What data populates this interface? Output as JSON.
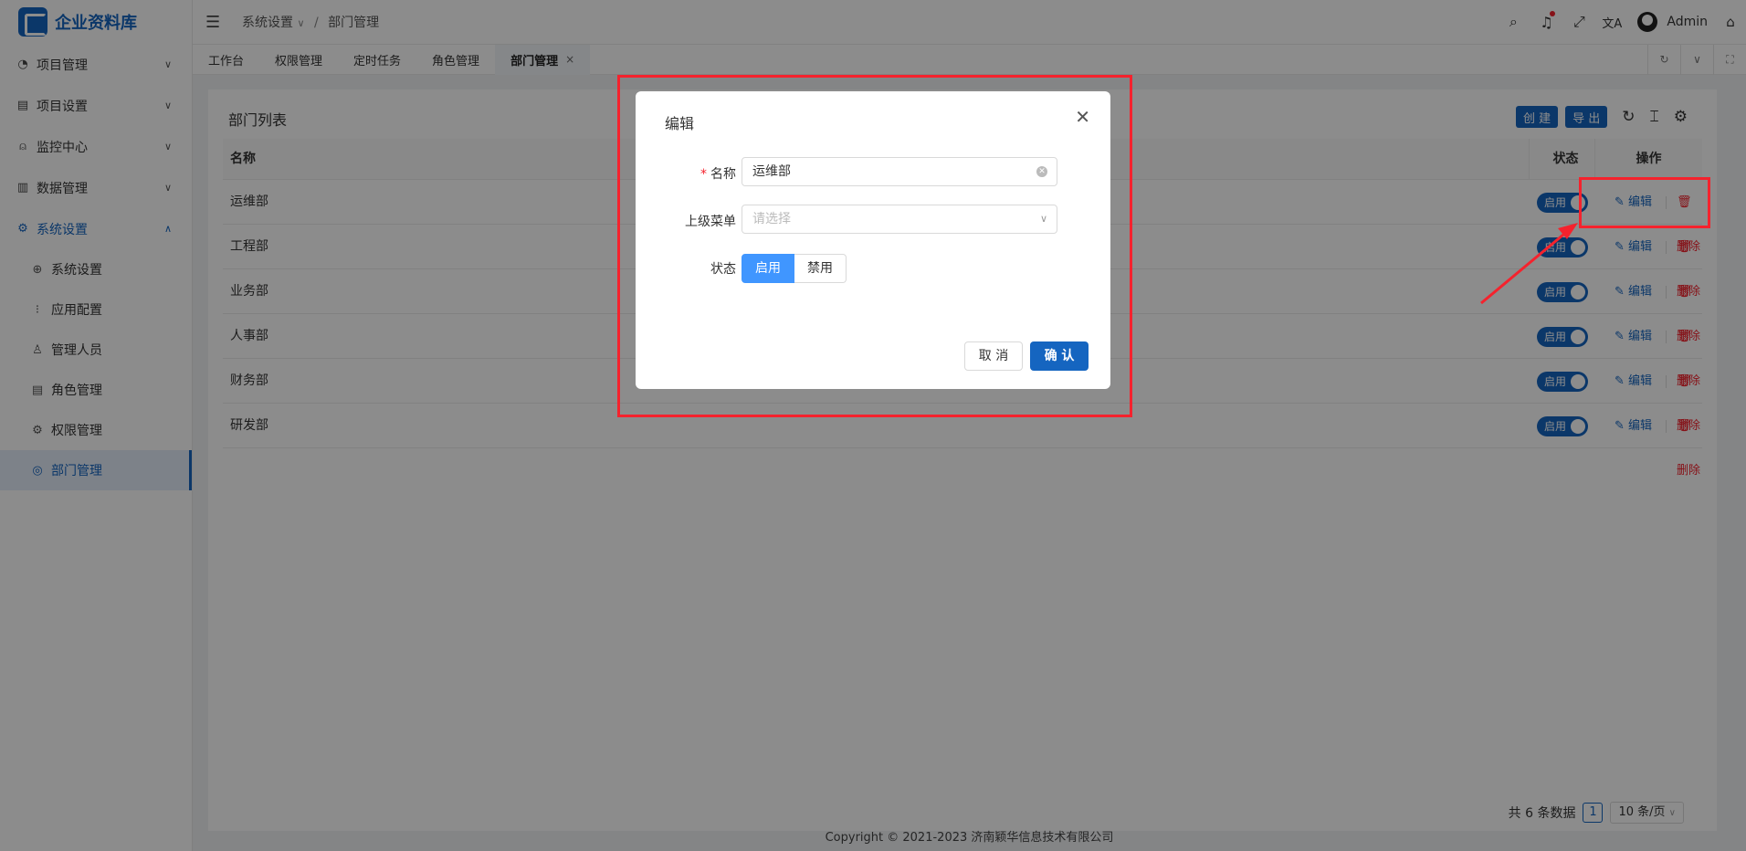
{
  "app": {
    "title": "企业资料库"
  },
  "sidebar": {
    "groups": [
      {
        "label": "项目管理",
        "icon": "dashboard-icon"
      },
      {
        "label": "项目设置",
        "icon": "list-icon"
      },
      {
        "label": "监控中心",
        "icon": "alarm-icon"
      },
      {
        "label": "数据管理",
        "icon": "document-icon"
      },
      {
        "label": "系统设置",
        "icon": "gear-icon"
      }
    ],
    "sub_items": [
      {
        "label": "系统设置",
        "icon": "globe-icon"
      },
      {
        "label": "应用配置",
        "icon": "grid-dots-icon"
      },
      {
        "label": "管理人员",
        "icon": "user-icon"
      },
      {
        "label": "角色管理",
        "icon": "role-doc-icon"
      },
      {
        "label": "权限管理",
        "icon": "gear-icon"
      },
      {
        "label": "部门管理",
        "icon": "department-icon"
      }
    ]
  },
  "header": {
    "breadcrumb": [
      "系统设置",
      "部门管理"
    ],
    "user": "Admin"
  },
  "tabs": [
    {
      "label": "工作台"
    },
    {
      "label": "权限管理"
    },
    {
      "label": "定时任务"
    },
    {
      "label": "角色管理"
    },
    {
      "label": "部门管理",
      "close": "×"
    }
  ],
  "page": {
    "title": "部门列表",
    "create_label": "创 建",
    "export_label": "导 出"
  },
  "table": {
    "headers": {
      "name": "名称",
      "status": "状态",
      "actions": "操作"
    },
    "rows": [
      {
        "name": "运维部",
        "status": "启用"
      },
      {
        "name": "工程部",
        "status": "启用"
      },
      {
        "name": "业务部",
        "status": "启用"
      },
      {
        "name": "人事部",
        "status": "启用"
      },
      {
        "name": "财务部",
        "status": "启用"
      },
      {
        "name": "研发部",
        "status": "启用"
      }
    ],
    "edit_label": "编辑",
    "delete_label": "删除"
  },
  "pagination": {
    "total_text": "共 6 条数据",
    "current_page": "1",
    "page_size": "10 条/页"
  },
  "footer": {
    "copyright": "Copyright © 2021-2023 济南颖华信息技术有限公司"
  },
  "modal": {
    "title": "编辑",
    "name_label": "名称",
    "name_value": "运维部",
    "parent_label": "上级菜单",
    "parent_placeholder": "请选择",
    "status_label": "状态",
    "status_options": [
      "启用",
      "禁用"
    ],
    "status_selected": "启用",
    "cancel_label": "取 消",
    "confirm_label": "确 认"
  },
  "colors": {
    "primary": "#1565c0",
    "danger": "#f5222d",
    "annotation": "#f5222d"
  }
}
